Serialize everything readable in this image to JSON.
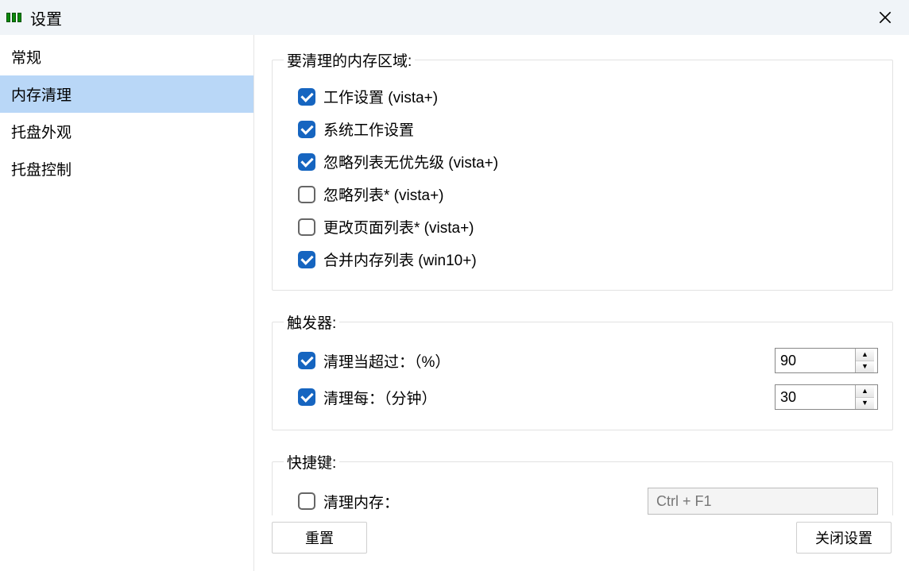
{
  "title": "设置",
  "sidebar": {
    "items": [
      {
        "label": "常规",
        "selected": false
      },
      {
        "label": "内存清理",
        "selected": true
      },
      {
        "label": "托盘外观",
        "selected": false
      },
      {
        "label": "托盘控制",
        "selected": false
      }
    ]
  },
  "groups": {
    "areas": {
      "legend": "要清理的内存区域:",
      "options": [
        {
          "label": "工作设置 (vista+)",
          "checked": true
        },
        {
          "label": "系统工作设置",
          "checked": true
        },
        {
          "label": "忽略列表无优先级 (vista+)",
          "checked": true
        },
        {
          "label": "忽略列表* (vista+)",
          "checked": false
        },
        {
          "label": "更改页面列表* (vista+)",
          "checked": false
        },
        {
          "label": "合并内存列表 (win10+)",
          "checked": true
        }
      ]
    },
    "triggers": {
      "legend": "触发器:",
      "percent": {
        "label": "清理当超过：（%）",
        "checked": true,
        "value": "90"
      },
      "minutes": {
        "label": "清理每：（分钟）",
        "checked": true,
        "value": "30"
      }
    },
    "hotkey": {
      "legend": "快捷键:",
      "option": {
        "label": "清理内存：",
        "checked": false,
        "value": "Ctrl + F1"
      }
    }
  },
  "footer": {
    "reset": "重置",
    "close": "关闭设置"
  }
}
